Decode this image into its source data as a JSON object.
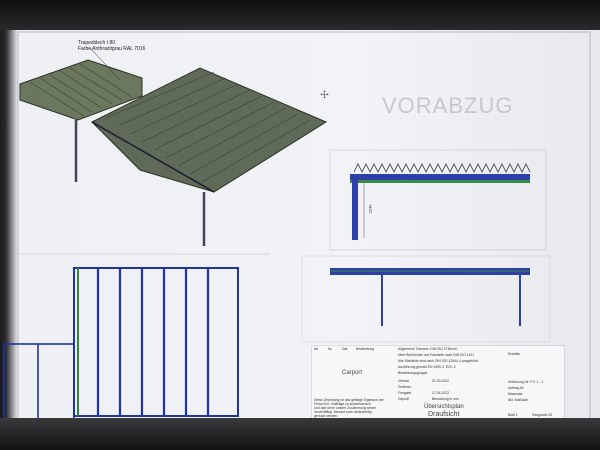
{
  "watermark": "VORABZUG",
  "roof_note": {
    "line1": "Trapezblech t 80",
    "line2": "Farbe Anthrazitgrau  RAL 7016"
  },
  "section_dimension": "2240",
  "title_block": {
    "header": [
      "Art",
      "Nr.",
      "Dat.",
      "Bearbeitung"
    ],
    "project": "Carport",
    "note_lines": [
      "Diese Zeichnung ist das geistige Eigentum der",
      "Firma M.K. Aufträge zu schweizerisch",
      "und darf ohne unsere Zustimmung weder",
      "vervielfältigt, benutzt noch anderweitig",
      "genutzt werden."
    ],
    "spec_lines": [
      "Allgemeine Toleranz: DIN ISO 2768 mK",
      "Über Bohrlöcher und Passteile nach DIN ISO 1101",
      "Alle Stahlteile sind nach DIN ISO 12944-4 ausgeführt",
      "Ausführung gemäß EN 1090-2, EXC 2",
      "Bewehrungsgruppe"
    ],
    "rows": [
      {
        "label": "Version",
        "value": "21.03.2022"
      },
      {
        "label": "Zeichner",
        "value": ""
      },
      {
        "label": "Freigabe",
        "value": "27.04.2022"
      },
      {
        "label": "Geprüft",
        "value": "Bemaßung in mm"
      }
    ],
    "right_col": [
      "Ersteller",
      "Zeichnung-Nr. P 0 1 - 1"
    ],
    "auftrag_lines": [
      "Auftrag-Nr.",
      "Massstab",
      "Akt. Maßstab"
    ],
    "sheet_title": "Übersichtsplan",
    "sheet_subtitle": "Draufsicht",
    "sheet": "Blatt 1",
    "format": "Rangstufe A3"
  }
}
